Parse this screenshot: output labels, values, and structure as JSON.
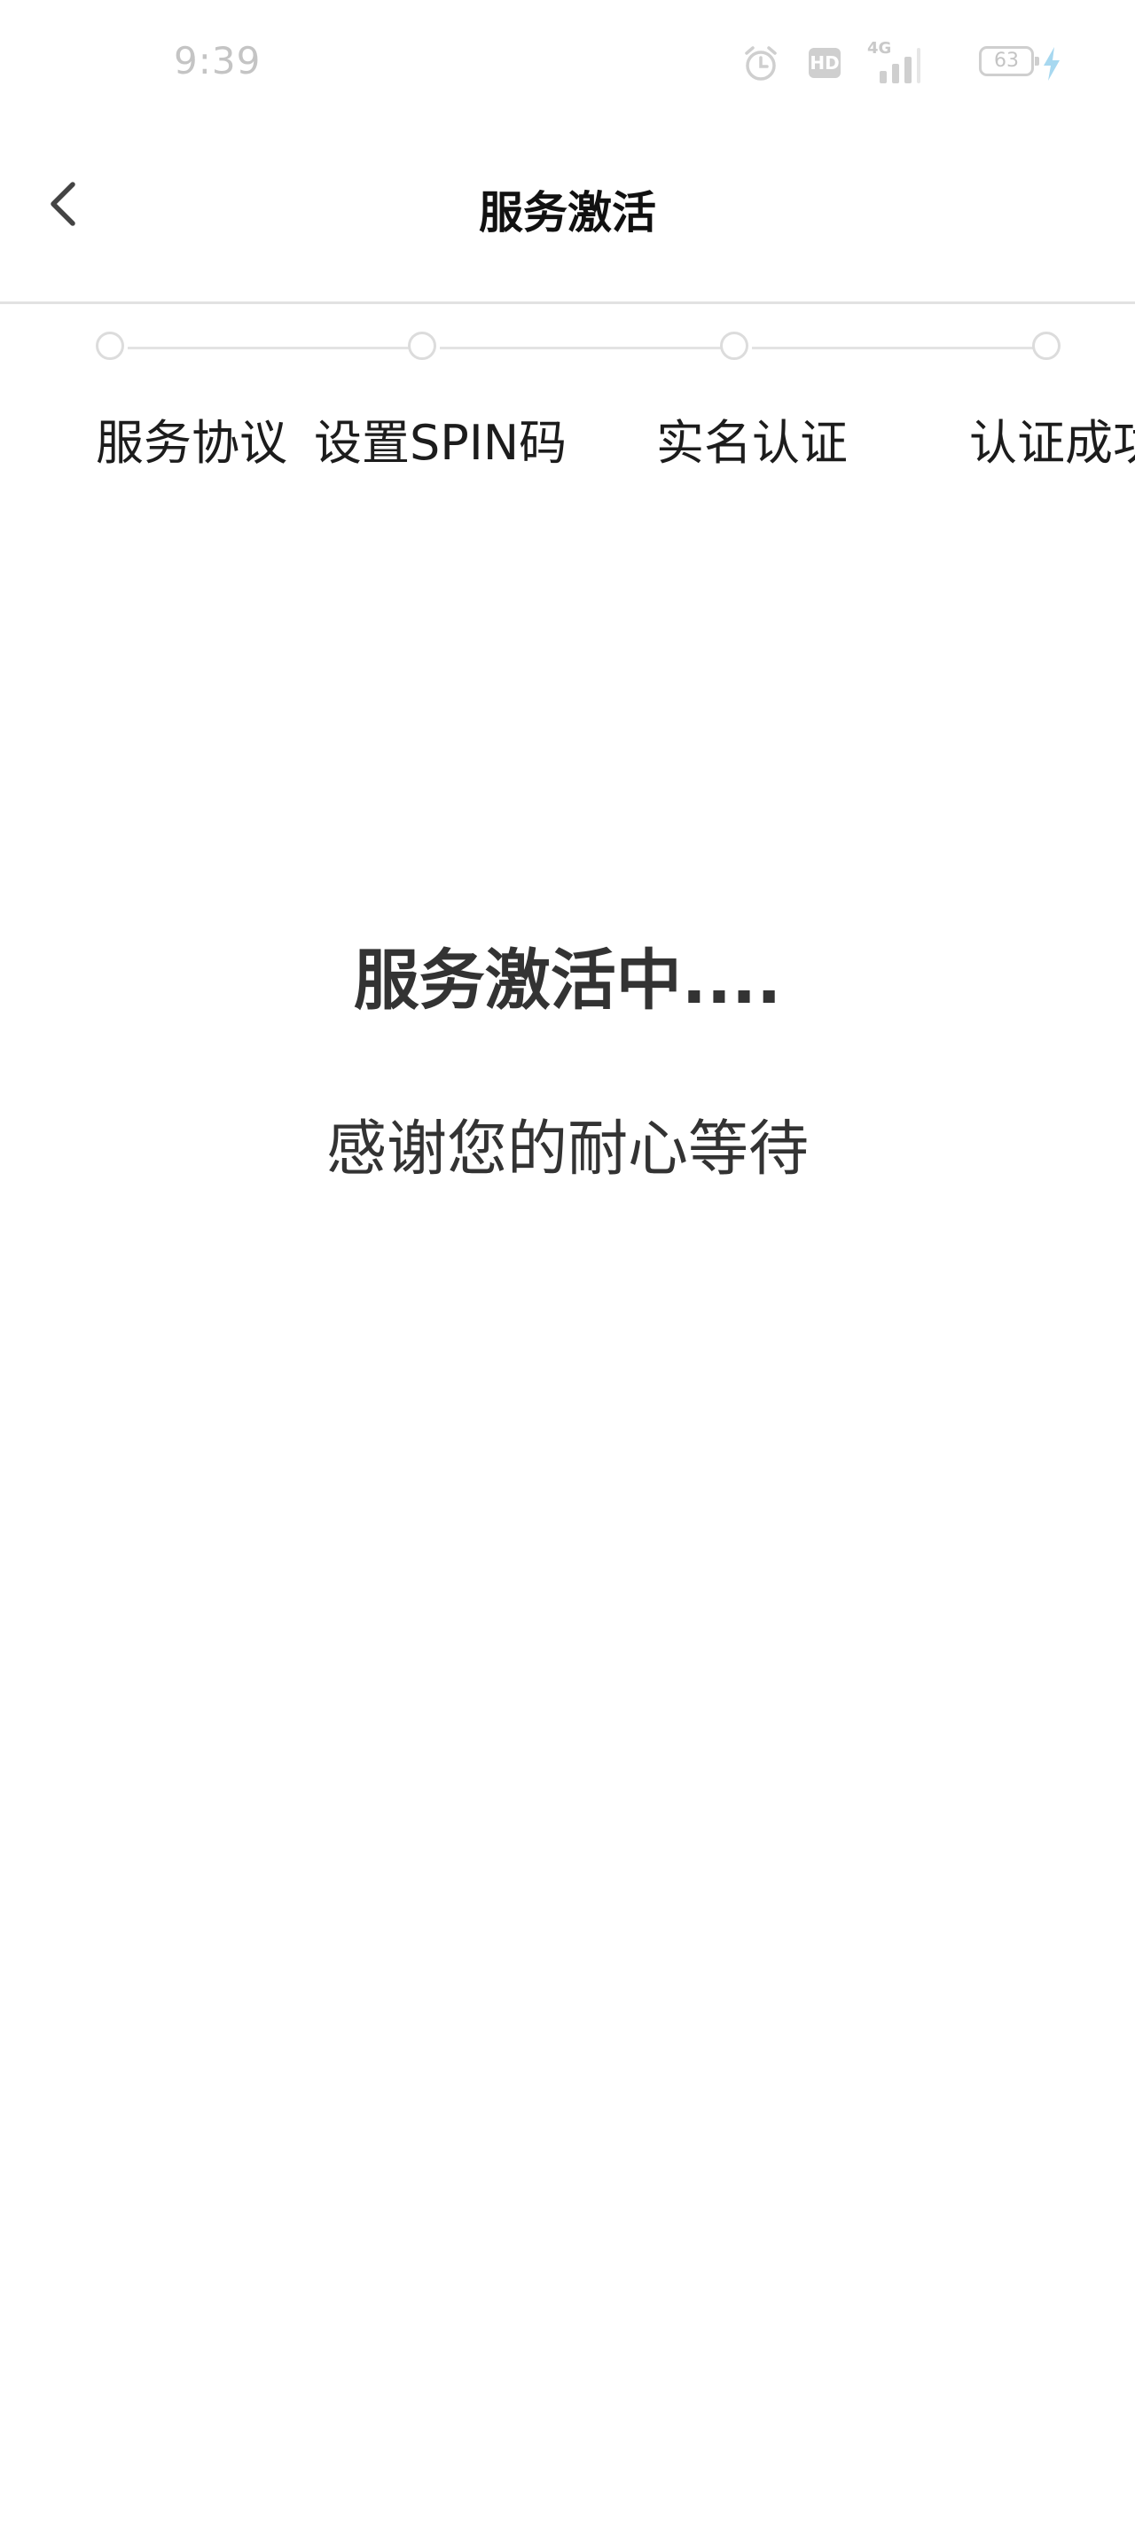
{
  "status_bar": {
    "time": "9:39",
    "network_label": "4G",
    "hd_label": "HD",
    "battery_level": "63",
    "icons": [
      "alarm-icon",
      "hd-icon",
      "signal-icon",
      "battery-icon",
      "charging-icon"
    ]
  },
  "header": {
    "back_icon": "chevron-left-icon",
    "title": "服务激活"
  },
  "stepper": {
    "steps": [
      {
        "label": "服务协议"
      },
      {
        "label": "设置SPIN码"
      },
      {
        "label": "实名认证"
      },
      {
        "label": "认证成功"
      }
    ]
  },
  "main": {
    "status_title": "服务激活中....",
    "status_subtitle": "感谢您的耐心等待"
  },
  "colors": {
    "background": "#ffffff",
    "text_primary": "#111111",
    "text_secondary": "#333333",
    "divider": "#e2e2e2",
    "status_icon": "#cfcfcf",
    "charging": "#a7d8f0"
  }
}
